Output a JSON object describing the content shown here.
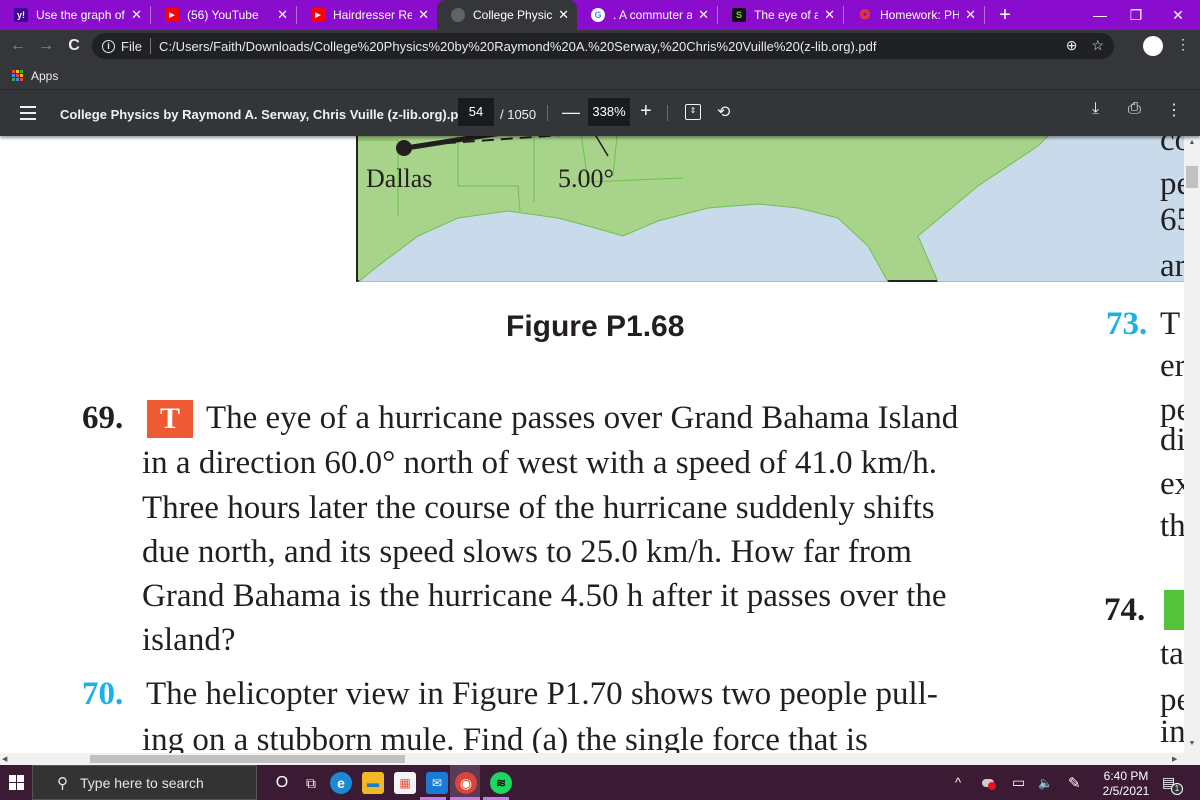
{
  "browser": {
    "tabs": [
      {
        "title": "Use the graph of t",
        "favicon": "yahoo-answers-icon",
        "favicon_color": "#400090",
        "favicon_text": "y!",
        "active": false
      },
      {
        "title": "(56) YouTube",
        "favicon": "youtube-icon",
        "favicon_color": "#ff0000",
        "favicon_text": "▶",
        "active": false
      },
      {
        "title": "Hairdresser Reacts",
        "favicon": "youtube-icon",
        "favicon_color": "#ff0000",
        "favicon_text": "▶",
        "active": false
      },
      {
        "title": "College Physics by",
        "favicon": "globe-icon",
        "favicon_color": "#5f6368",
        "favicon_text": "◍",
        "active": true
      },
      {
        "title": ". A commuter airpl",
        "favicon": "google-icon",
        "favicon_color": "#ffffff",
        "favicon_text": "G",
        "active": false
      },
      {
        "title": "The eye of a hurric",
        "favicon": "studysoup-icon",
        "favicon_color": "#111111",
        "favicon_text": "S",
        "active": false
      },
      {
        "title": "Homework: PHYS-",
        "favicon": "canvas-icon",
        "favicon_color": "#e13f2b",
        "favicon_text": "❂",
        "active": false
      }
    ],
    "close_glyph": "✕",
    "new_tab_glyph": "+",
    "window_controls": {
      "minimize": "—",
      "restore": "❐",
      "close": "✕"
    },
    "nav": {
      "back": "←",
      "forward": "→",
      "reload": "C"
    },
    "address": {
      "info_glyph": "i",
      "scheme_label": "File",
      "url": "C:/Users/Faith/Downloads/College%20Physics%20by%20Raymond%20A.%20Serway,%20Chris%20Vuille%20(z-lib.org).pdf"
    },
    "omnibox_icons": {
      "zoom": "⊕",
      "bookmark": "☆"
    },
    "menu_glyph": "⋮",
    "bookmarks": {
      "apps_label": "Apps"
    }
  },
  "pdf_viewer": {
    "title": "College Physics by Raymond A. Serway, Chris Vuille (z-lib.org).pdf",
    "current_page": "54",
    "total_pages": "/ 1050",
    "zoom_minus": "—",
    "zoom_level": "338%",
    "zoom_plus": "+",
    "fit_glyph": "⇕",
    "rotate_glyph": "⟲",
    "download_glyph": "⤓",
    "print_glyph": "⎙",
    "more_glyph": "⋮"
  },
  "document": {
    "map": {
      "city_label": "Dallas",
      "angle_label": "5.00°"
    },
    "figure_caption": "Figure P1.68",
    "problem_69": {
      "number": "69.",
      "badge": "T",
      "badge_color": "#ee5a34",
      "lines": [
        "The eye of a hurricane passes over Grand Bahama Island",
        "in a direction 60.0° north of west with a speed of 41.0 km/h.",
        "Three hours later the course of the hurricane suddenly shifts",
        "due north, and its speed slows to 25.0 km/h. How far from",
        "Grand Bahama is the hurricane 4.50 h after it passes over the",
        "island?"
      ]
    },
    "problem_70": {
      "number": "70.",
      "number_color": "#1ab0e8",
      "lines": [
        "The helicopter view in Figure P1.70 shows two people pull-",
        "ing on a stubborn mule. Find (a) the single force that is"
      ]
    },
    "right_column": {
      "fragments_top": [
        "co",
        "pe",
        "65",
        "ar"
      ],
      "problem_73_number": "73.",
      "problem_73_fragments": [
        "T",
        "er",
        "pe",
        "di",
        "ex",
        "th"
      ],
      "problem_74_number": "74.",
      "problem_74_fragments": [
        "ta",
        "pe",
        "in"
      ],
      "badge_color": "#54c23b"
    }
  },
  "taskbar": {
    "search_placeholder": "Type here to search",
    "search_glyph": "⚲",
    "apps": [
      {
        "name": "cortana-icon",
        "glyph": "O",
        "color": "transparent"
      },
      {
        "name": "task-view-icon",
        "glyph": "⧉",
        "color": "transparent"
      },
      {
        "name": "edge-icon",
        "glyph": "e",
        "color": "#1a8ad4"
      },
      {
        "name": "file-explorer-icon",
        "glyph": "▬",
        "color": "#f2b824"
      },
      {
        "name": "store-icon",
        "glyph": "▦",
        "color": "#f4f4f4"
      },
      {
        "name": "mail-icon",
        "glyph": "✉",
        "color": "#1a7ad4"
      },
      {
        "name": "chrome-icon",
        "glyph": "◉",
        "color": "#db4437"
      },
      {
        "name": "spotify-icon",
        "glyph": "≋",
        "color": "#1ed760"
      }
    ],
    "tray": {
      "chevron": "^",
      "volume_glyph": "🔈",
      "battery_glyph": "▭",
      "pen_glyph": "✎"
    },
    "time": "6:40 PM",
    "date": "2/5/2021",
    "notification_count": "1",
    "notification_glyph": "▤"
  }
}
